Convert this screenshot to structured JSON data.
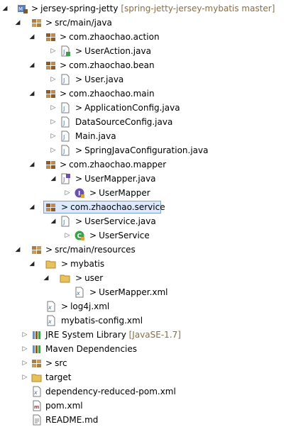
{
  "project": {
    "name": "jersey-spring-jetty",
    "repo_label": "[spring-jetty-jersey-mybatis master]"
  },
  "nodes": {
    "src_main_java": "src/main/java",
    "pkg_action": "com.zhaochao.action",
    "user_action": "UserAction.java",
    "pkg_bean": "com.zhaochao.bean",
    "user_java": "User.java",
    "pkg_main": "com.zhaochao.main",
    "app_config": "ApplicationConfig.java",
    "ds_config": "DataSourceConfig.java",
    "main_java": "Main.java",
    "spring_config": "SpringJavaConfiguration.java",
    "pkg_mapper": "com.zhaochao.mapper",
    "user_mapper_java": "UserMapper.java",
    "user_mapper_iface": "UserMapper",
    "pkg_service": "com.zhaochao.service",
    "user_service_java": "UserService.java",
    "user_service_class": "UserService",
    "src_main_resources": "src/main/resources",
    "mybatis": "mybatis",
    "user_folder": "user",
    "user_mapper_xml": "UserMapper.xml",
    "log4j": "log4j.xml",
    "mybatis_config": "mybatis-config.xml",
    "jre": "JRE System Library",
    "jre_version": "[JavaSE-1.7]",
    "maven_deps": "Maven Dependencies",
    "src": "src",
    "target": "target",
    "dep_reduced_pom": "dependency-reduced-pom.xml",
    "pom": "pom.xml",
    "readme": "README.md"
  },
  "glyphs": {
    "expanded": "◢",
    "collapsed": "▷",
    "dirty_prefix": ">"
  },
  "colors": {
    "selection_bg": "#dbe9fb",
    "selection_border": "#7da2ce",
    "decoration": "#8d6c3d",
    "package_brown": "#8c5a2c",
    "folder_yellow": "#e8c15a",
    "java_file_blue": "#3b6fb6",
    "class_green": "#3aa04a",
    "interface_purple": "#6b4fb1"
  }
}
